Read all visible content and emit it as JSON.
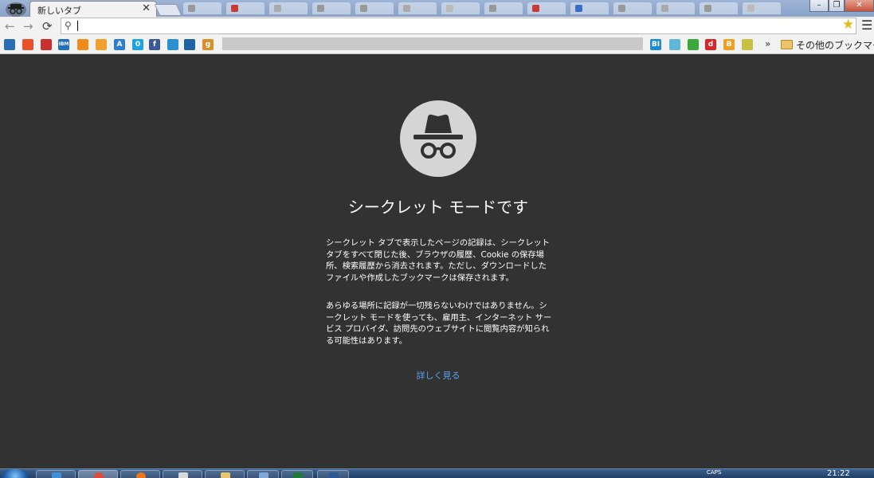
{
  "browser": {
    "active_tab": {
      "title": "新しいタブ",
      "close_glyph": "✕"
    },
    "window_buttons": [
      "–",
      "❐",
      "✕"
    ],
    "nav": {
      "back": "←",
      "forward": "→",
      "reload": "⟳"
    },
    "omnibox": {
      "value": "",
      "placeholder": "",
      "search_glyph": "⚲"
    },
    "star_glyph": "★",
    "menu_glyph": "☰"
  },
  "bookmarks": {
    "items": [
      {
        "icon": "bookmark-icon-1",
        "text": "",
        "color": "#2a6db0"
      },
      {
        "icon": "bookmark-icon-2",
        "text": "",
        "color": "#e8522a"
      },
      {
        "icon": "bookmark-icon-3",
        "text": "",
        "color": "#c8312d"
      },
      {
        "icon": "ibm-icon",
        "text": "IBM",
        "color": "#1f70c1"
      },
      {
        "icon": "bookmark-icon-5",
        "text": "",
        "color": "#f08a1c"
      },
      {
        "icon": "bookmark-icon-6",
        "text": "",
        "color": "#f0a030"
      },
      {
        "icon": "bookmark-icon-7",
        "text": "A",
        "color": "#2a7fd4"
      },
      {
        "icon": "bookmark-icon-8",
        "text": "0",
        "color": "#1fa2e0"
      },
      {
        "icon": "facebook-icon",
        "text": "f",
        "color": "#3b5998"
      },
      {
        "icon": "bookmark-icon-10",
        "text": "",
        "color": "#2b8fd0"
      },
      {
        "icon": "bookmark-icon-11",
        "text": "",
        "color": "#1d63a8"
      },
      {
        "icon": "bookmark-icon-12",
        "text": "g",
        "color": "#d8902a"
      }
    ],
    "right_items": [
      {
        "icon": "bi-icon",
        "text": "BI",
        "color": "#1d8ad6"
      },
      {
        "icon": "bookmark-icon-r2",
        "text": "",
        "color": "#5fb8d8"
      },
      {
        "icon": "evernote-icon",
        "text": "",
        "color": "#3aa83a"
      },
      {
        "icon": "d-icon",
        "text": "d",
        "color": "#d8262a"
      },
      {
        "icon": "b-icon",
        "text": "B",
        "color": "#f0a020"
      },
      {
        "icon": "bookmark-icon-r6",
        "text": "",
        "color": "#c8c040"
      }
    ],
    "overflow": "»",
    "other_folder": "その他のブックマーク"
  },
  "incognito": {
    "heading": "シークレット モードです",
    "para1": "シークレット タブで表示したページの記録は、シークレット タブをすべて閉じた後、ブラウザの履歴、Cookie の保存場所、検索履歴から消去されます。ただし、ダウンロードしたファイルや作成したブックマークは保存されます。",
    "para2": "あらゆる場所に記録が一切残らないわけではありません。シークレット モードを使っても、雇用主、インターネット サービス プロバイダ、訪問先のウェブサイトに閲覧内容が知られる可能性はあります。",
    "learn_more": "詳しく見る"
  },
  "taskbar": {
    "clock": "21:22",
    "tray_text": "CAPS"
  },
  "colors": {
    "background": "#323232",
    "link": "#5aa2ea",
    "logo_circle": "#d5d5d5",
    "logo_glyph": "#323232"
  }
}
